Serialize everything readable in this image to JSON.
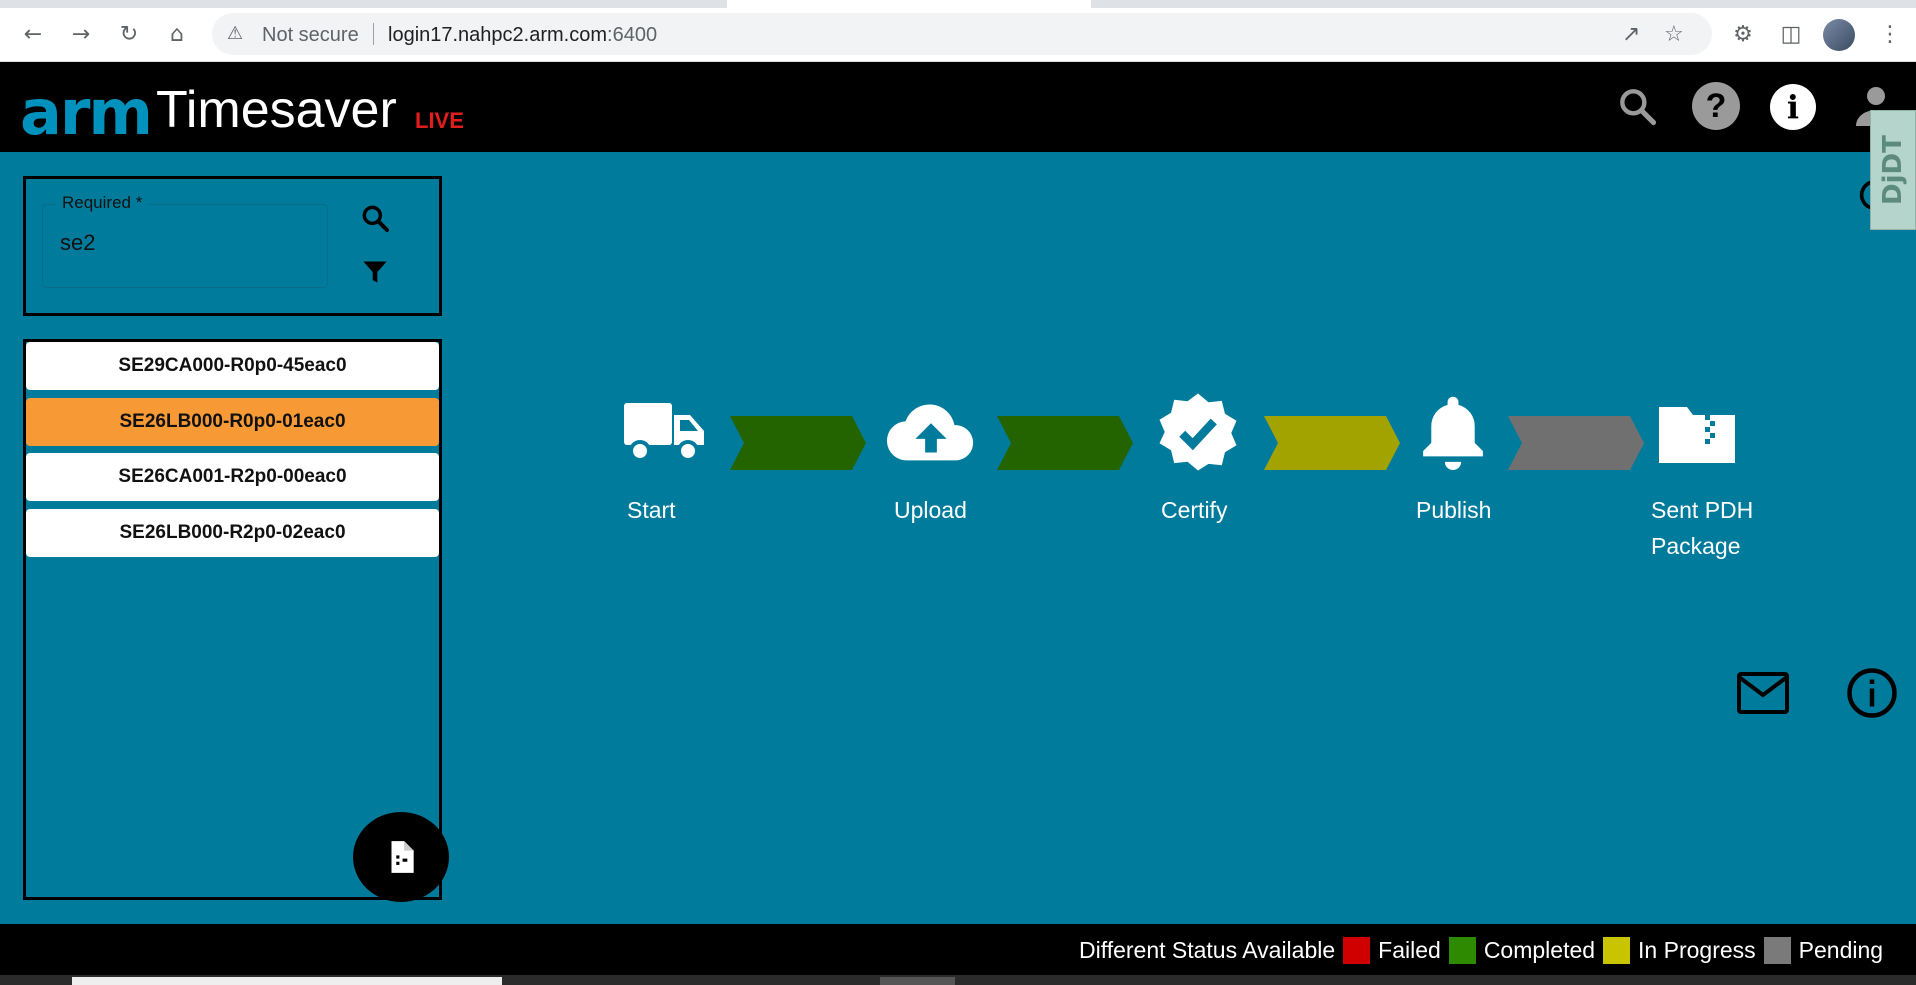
{
  "browser": {
    "security_label": "Not secure",
    "url_host": "login17.nahpc2.arm.com",
    "url_port": ":6400"
  },
  "app": {
    "logo_brand": "arm",
    "title": "Timesaver",
    "badge": "LIVE",
    "brand_color": "#0091bd",
    "header_icons": [
      "search-icon",
      "help-icon",
      "info-icon",
      "user-icon"
    ]
  },
  "search": {
    "label": "Required *",
    "value": "se2"
  },
  "results": [
    {
      "label": "SE29CA000-R0p0-45eac0",
      "selected": false
    },
    {
      "label": "SE26LB000-R0p0-01eac0",
      "selected": true
    },
    {
      "label": "SE26CA001-R2p0-00eac0",
      "selected": false
    },
    {
      "label": "SE26LB000-R2p0-02eac0",
      "selected": false
    }
  ],
  "workflow": {
    "steps": [
      {
        "label": "Start",
        "icon": "truck-icon"
      },
      {
        "label": "Upload",
        "icon": "cloud-upload-icon"
      },
      {
        "label": "Certify",
        "icon": "verified-badge-icon"
      },
      {
        "label": "Publish",
        "icon": "bell-icon"
      },
      {
        "label": "Sent PDH",
        "label2": "Package",
        "icon": "folder-zip-icon"
      }
    ],
    "connectors": [
      {
        "status": "Completed",
        "color": "#246400"
      },
      {
        "status": "Completed",
        "color": "#246400"
      },
      {
        "status": "In Progress",
        "color": "#a2a300"
      },
      {
        "status": "Pending",
        "color": "#707070"
      }
    ]
  },
  "footer": {
    "title": "Different Status Available",
    "statuses": [
      {
        "label": "Failed",
        "color": "#d10000"
      },
      {
        "label": "Completed",
        "color": "#2e8a00"
      },
      {
        "label": "In Progress",
        "color": "#c9c400"
      },
      {
        "label": "Pending",
        "color": "#7a7a7a"
      }
    ]
  },
  "debug_toolbar": {
    "label": "DjDT"
  }
}
